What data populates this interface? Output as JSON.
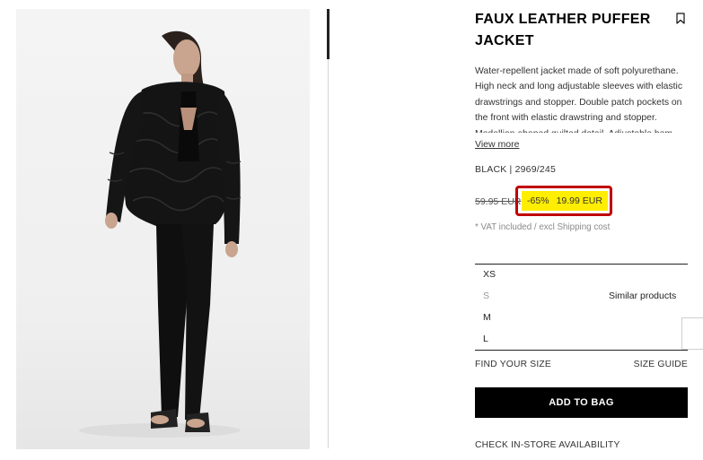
{
  "product": {
    "title": "FAUX LEATHER PUFFER JACKET",
    "description": "Water-repellent jacket made of soft polyurethane. High neck and long adjustable sleeves with elastic drawstrings and stopper. Double patch pockets on the front with elastic drawstring and stopper. Medallion-shaped quilted detail. Adjustable hem",
    "view_more_label": "View more",
    "color_ref": "BLACK | 2969/245",
    "old_price": "59.95 EUR",
    "discount": "-65%",
    "sale_price": "19.99 EUR",
    "vat_note": "* VAT included / excl Shipping cost",
    "highlight_color": "#c00000",
    "sale_bg_color": "#ffee00"
  },
  "sizes": {
    "items": [
      {
        "label": "XS",
        "available": true
      },
      {
        "label": "S",
        "available": false
      },
      {
        "label": "M",
        "available": true
      },
      {
        "label": "L",
        "available": true
      }
    ],
    "similar_products_label": "Similar products"
  },
  "actions": {
    "find_your_size": "FIND YOUR SIZE",
    "size_guide": "SIZE GUIDE",
    "add_to_bag": "ADD TO BAG",
    "check_store": "CHECK IN-STORE AVAILABILITY"
  },
  "icons": {
    "bookmark": "bookmark-icon"
  }
}
